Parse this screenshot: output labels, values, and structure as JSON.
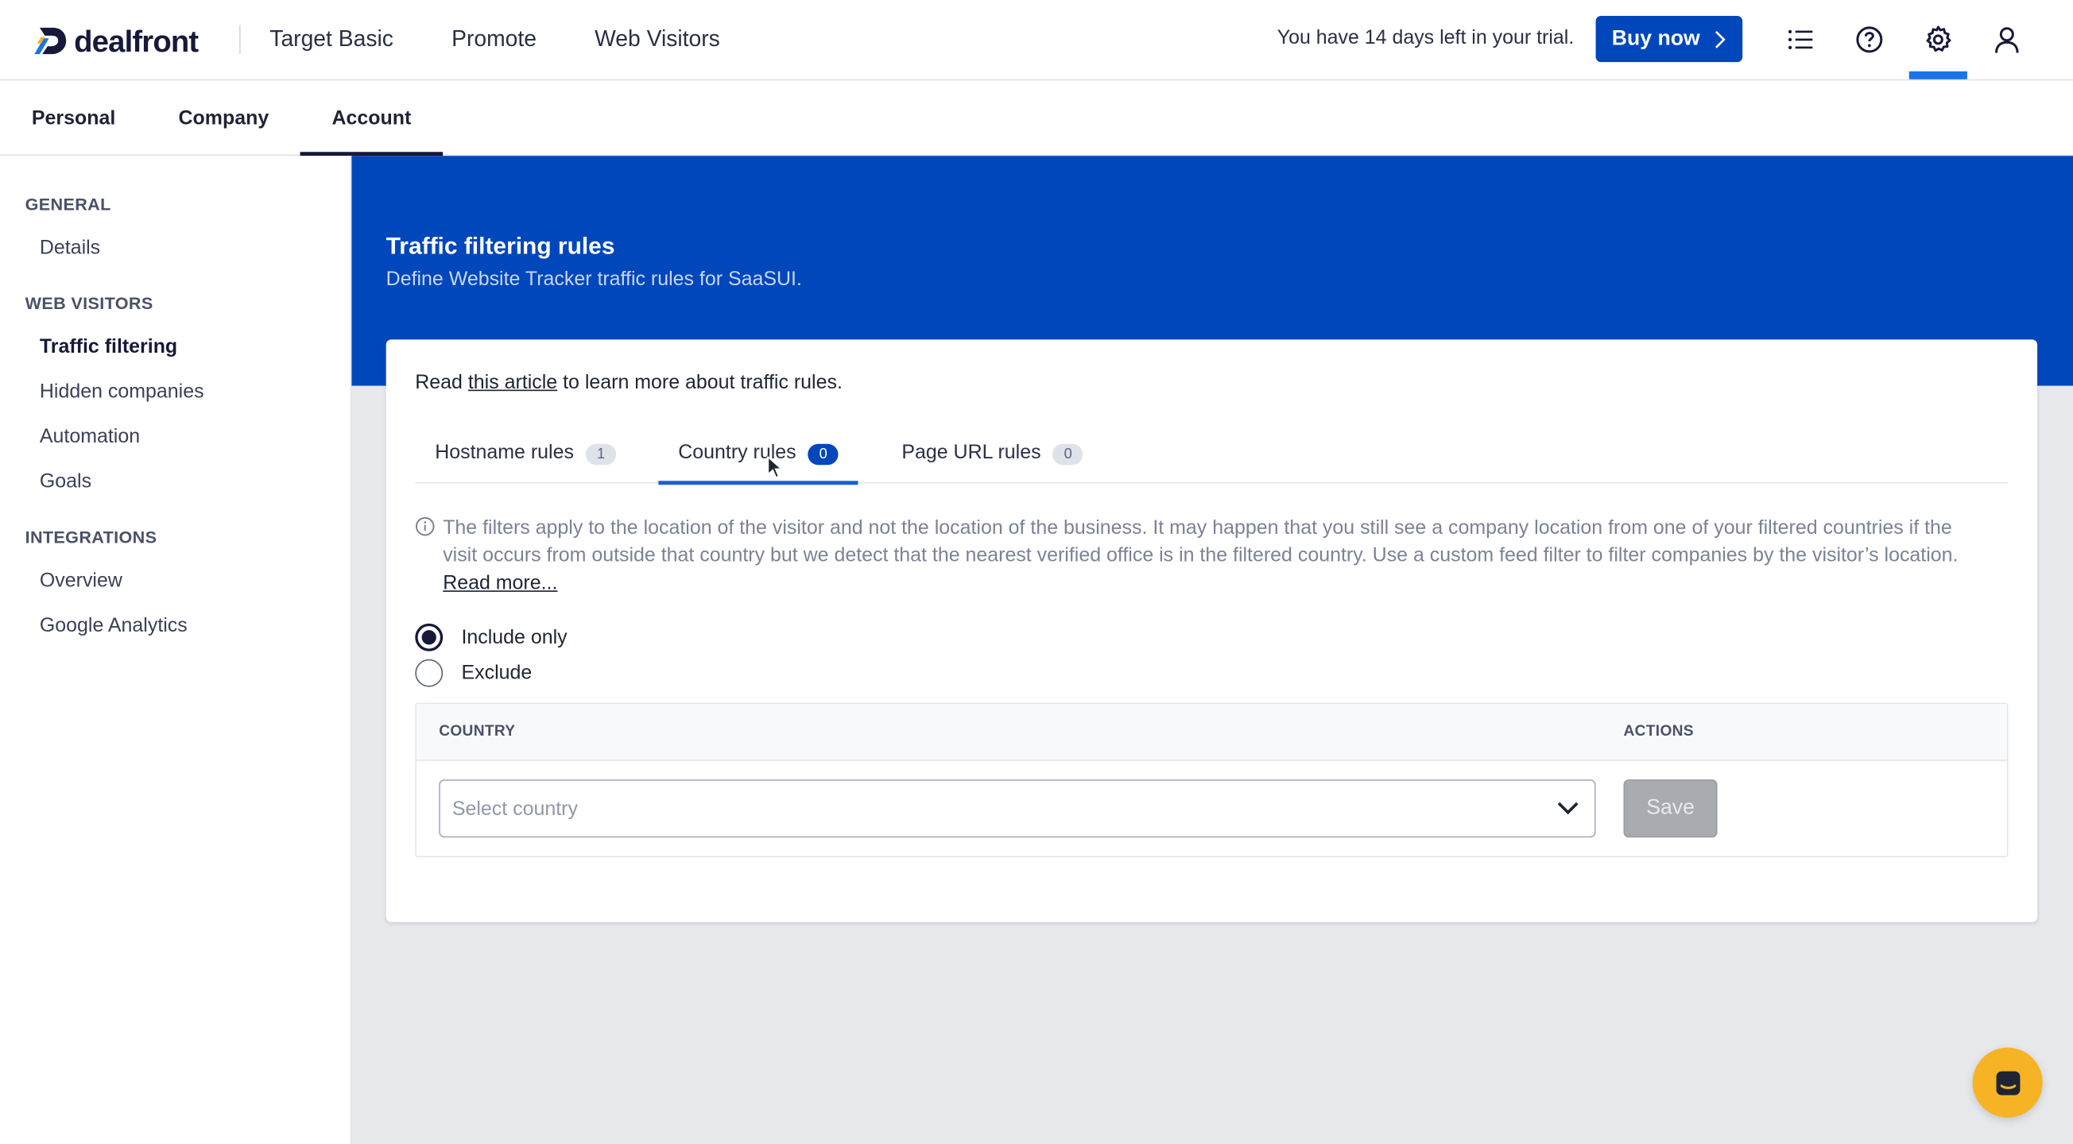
{
  "brand": {
    "name": "dealfront"
  },
  "topnav": {
    "items": [
      "Target Basic",
      "Promote",
      "Web Visitors"
    ],
    "trial_text": "You have 14 days left in your trial.",
    "buy_label": "Buy now"
  },
  "subnav": {
    "tabs": [
      "Personal",
      "Company",
      "Account"
    ],
    "active": "Account"
  },
  "sidebar": {
    "general_heading": "GENERAL",
    "general_items": [
      "Details"
    ],
    "web_heading": "WEB VISITORS",
    "web_items": [
      "Traffic filtering",
      "Hidden companies",
      "Automation",
      "Goals"
    ],
    "integrations_heading": "INTEGRATIONS",
    "integrations_items": [
      "Overview",
      "Google Analytics"
    ],
    "active": "Traffic filtering"
  },
  "page": {
    "title": "Traffic filtering rules",
    "subtitle": "Define Website Tracker traffic rules for SaaSUI."
  },
  "card": {
    "read_prefix": "Read ",
    "read_link": "this article",
    "read_suffix": " to learn more about traffic rules.",
    "tabs": [
      {
        "label": "Hostname rules",
        "count": "1"
      },
      {
        "label": "Country rules",
        "count": "0"
      },
      {
        "label": "Page URL rules",
        "count": "0"
      }
    ],
    "active_tab": "Country rules",
    "info_text": "The filters apply to the location of the visitor and not the location of the business. It may happen that you still see a company location from one of your filtered countries if the visit occurs from outside that country but we detect that the nearest verified office is in the filtered country. Use a custom feed filter to filter companies by the visitor’s location. ",
    "info_link": "Read more...",
    "radio_options": [
      "Include only",
      "Exclude"
    ],
    "selected_radio": "Include only",
    "table": {
      "col_country": "COUNTRY",
      "col_actions": "ACTIONS",
      "select_placeholder": "Select country",
      "save_label": "Save"
    }
  },
  "colors": {
    "brand_blue": "#0047bb",
    "chat_button": "#f6b424"
  }
}
